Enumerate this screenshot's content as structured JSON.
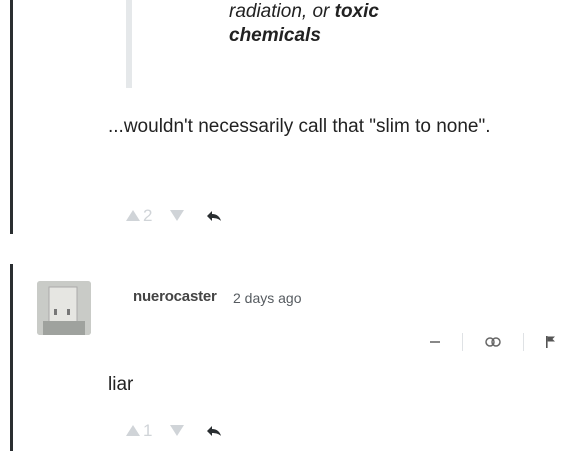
{
  "quote": {
    "line1_prefix": "radiation, or ",
    "line1_bold": "toxic",
    "line2_bold": "chemicals"
  },
  "comment1": {
    "body": "...wouldn't necessarily call that \"slim to none\".",
    "upvotes": "2"
  },
  "comment2": {
    "author": "nuerocaster",
    "timestamp": "2 days ago",
    "body": "liar",
    "upvotes": "1",
    "menu": {
      "collapse_icon": "minus-icon",
      "link_icon": "link-icon",
      "flag_icon": "flag-icon"
    }
  },
  "colors": {
    "thread_bar": "#2a2e31",
    "quote_bar": "#e5e8ea",
    "vote_muted": "#d0d4d8"
  }
}
